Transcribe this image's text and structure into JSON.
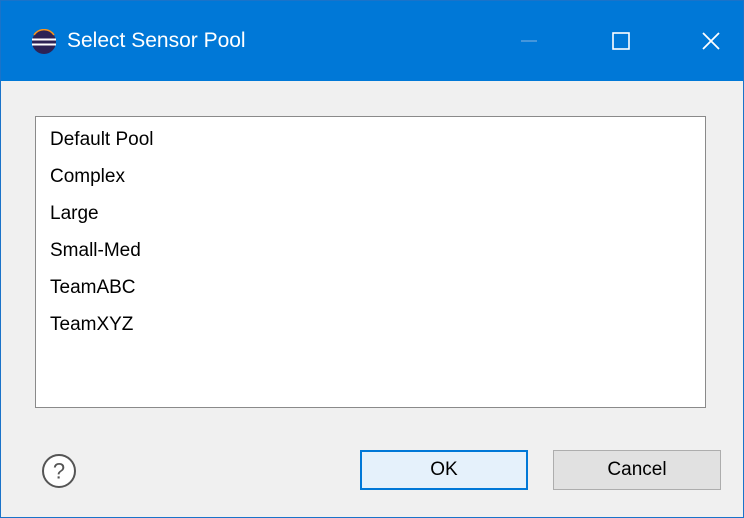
{
  "window": {
    "title": "Select Sensor Pool",
    "app_icon": "eclipse-icon",
    "title_bar_color": "#0078d7"
  },
  "pool_list": {
    "items": [
      {
        "label": "Default Pool"
      },
      {
        "label": "Complex"
      },
      {
        "label": "Large"
      },
      {
        "label": "Small-Med"
      },
      {
        "label": "TeamABC"
      },
      {
        "label": "TeamXYZ"
      }
    ]
  },
  "buttons": {
    "ok_label": "OK",
    "cancel_label": "Cancel",
    "help_icon": "help-icon",
    "focus_color": "#0078d7"
  },
  "window_controls": {
    "minimize_icon": "minimize-icon",
    "maximize_icon": "maximize-icon",
    "close_icon": "close-icon"
  }
}
